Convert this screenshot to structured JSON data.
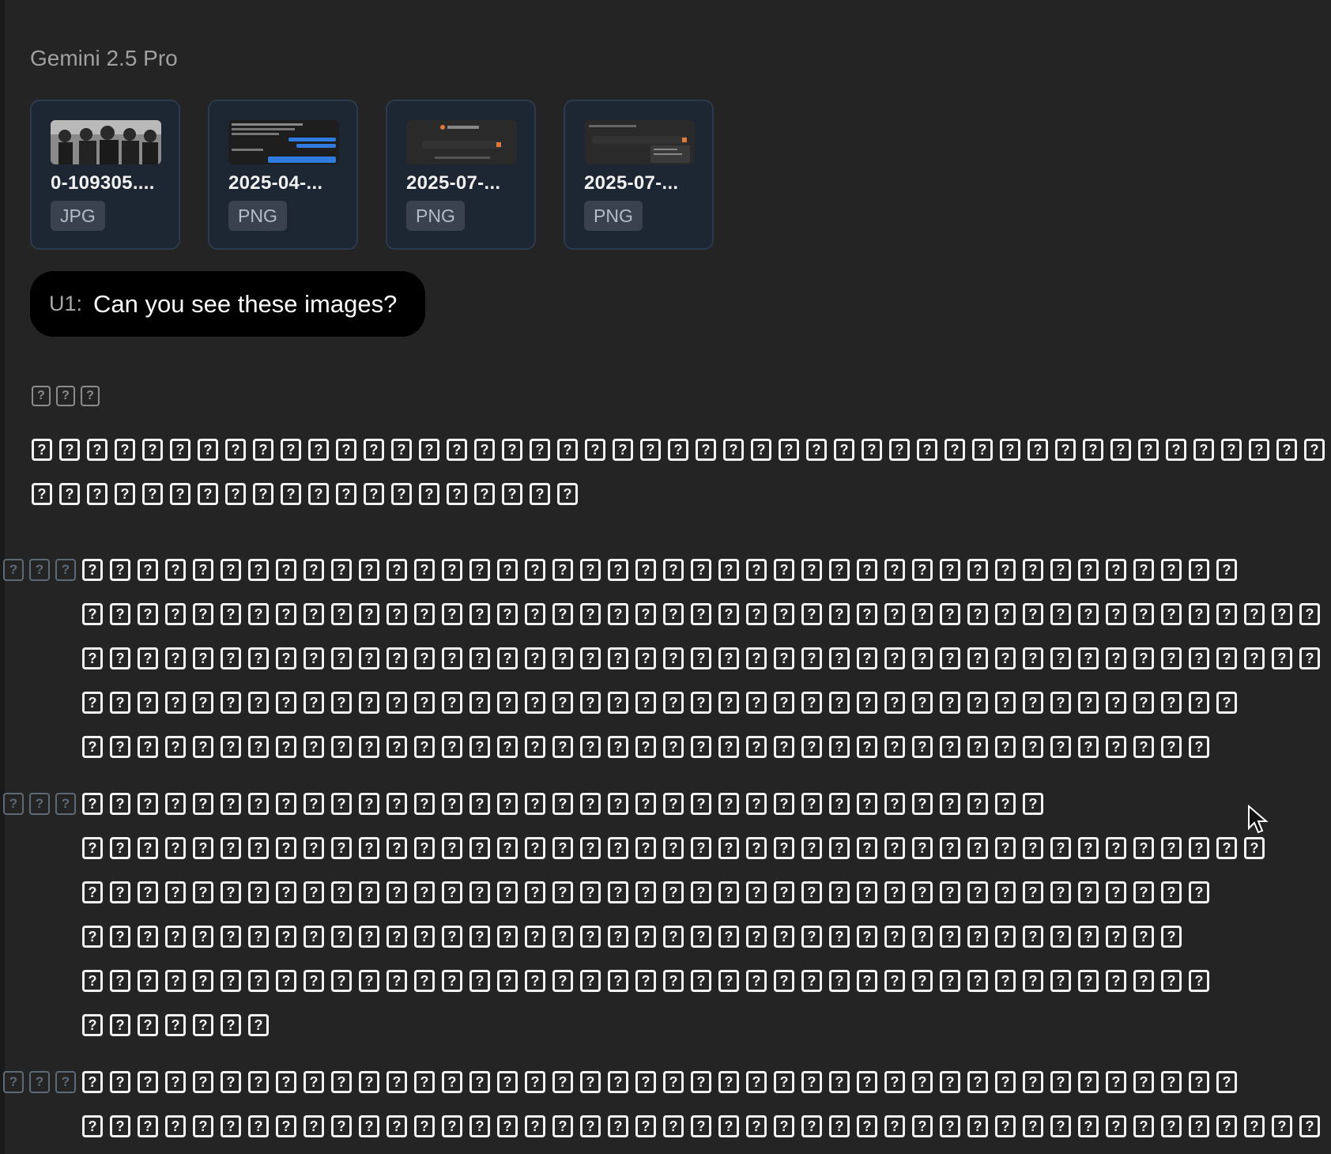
{
  "header": {
    "model_name": "Gemini 2.5 Pro"
  },
  "attachments": [
    {
      "filename": "0-109305....",
      "type": "JPG"
    },
    {
      "filename": "2025-04-...",
      "type": "PNG"
    },
    {
      "filename": "2025-07-...",
      "type": "PNG"
    },
    {
      "filename": "2025-07-...",
      "type": "PNG"
    }
  ],
  "user_message": {
    "prefix": "U1:",
    "text": "Can you see these images?"
  },
  "response": {
    "placeholder_glyph": "?"
  },
  "colors": {
    "background": "#242424",
    "attachment_bg": "#1d2633",
    "user_bubble": "#000000"
  }
}
